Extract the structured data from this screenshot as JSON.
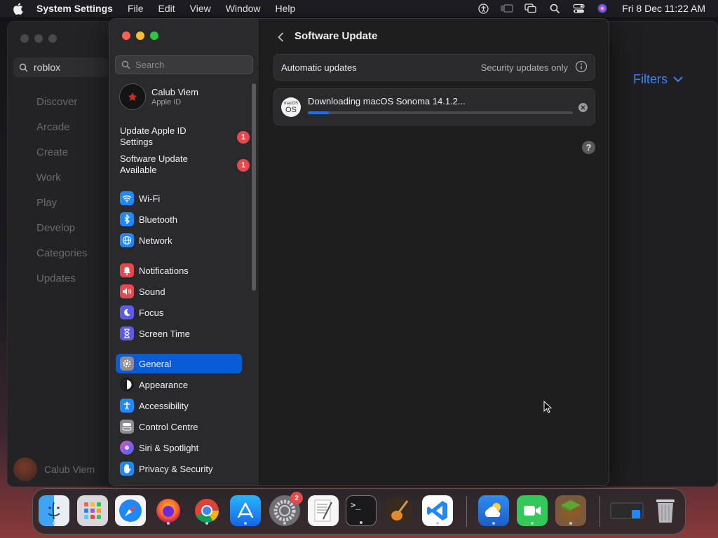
{
  "menubar": {
    "app_name": "System Settings",
    "menus": [
      "File",
      "Edit",
      "View",
      "Window",
      "Help"
    ],
    "clock": "Fri 8 Dec  11:22 AM"
  },
  "background_window": {
    "search_value": "roblox",
    "nav_items": [
      "Discover",
      "Arcade",
      "Create",
      "Work",
      "Play",
      "Develop",
      "Categories",
      "Updates"
    ],
    "user_name": "Calub Viem",
    "filters_label": "Filters"
  },
  "sidebar": {
    "search_placeholder": "Search",
    "account": {
      "name": "Calub Viem",
      "subtitle": "Apple ID"
    },
    "notices": [
      {
        "label": "Update Apple ID Settings",
        "badge": "1"
      },
      {
        "label": "Software Update Available",
        "badge": "1"
      }
    ],
    "items": [
      {
        "label": "Wi-Fi",
        "icon": "wifi-icon",
        "color": "#1e88ff"
      },
      {
        "label": "Bluetooth",
        "icon": "bluetooth-icon",
        "color": "#1e88ff"
      },
      {
        "label": "Network",
        "icon": "globe-icon",
        "color": "#1e88ff"
      },
      {
        "label": "Notifications",
        "icon": "bell-icon",
        "color": "#e5484d"
      },
      {
        "label": "Sound",
        "icon": "speaker-icon",
        "color": "#e5484d"
      },
      {
        "label": "Focus",
        "icon": "moon-icon",
        "color": "#5e5ce6"
      },
      {
        "label": "Screen Time",
        "icon": "hourglass-icon",
        "color": "#5e5ce6"
      },
      {
        "label": "General",
        "icon": "gear-icon",
        "color": "#8e8e93",
        "active": true
      },
      {
        "label": "Appearance",
        "icon": "appearance-icon",
        "color": "#1c1c1e"
      },
      {
        "label": "Accessibility",
        "icon": "accessibility-icon",
        "color": "#1e88ff"
      },
      {
        "label": "Control Centre",
        "icon": "toggles-icon",
        "color": "#8e8e93"
      },
      {
        "label": "Siri & Spotlight",
        "icon": "siri-icon",
        "color": "#b04fd6"
      },
      {
        "label": "Privacy & Security",
        "icon": "hand-icon",
        "color": "#1e88ff"
      }
    ]
  },
  "content": {
    "title": "Software Update",
    "auto_updates_label": "Automatic updates",
    "auto_updates_value": "Security updates only",
    "download_text": "Downloading macOS Sonoma 14.1.2...",
    "download_progress": 0.08,
    "macos_icon_top": "macOS",
    "macos_icon_bottom": "OS",
    "help_label": "?"
  },
  "dock": {
    "apps": [
      "Finder",
      "Launchpad",
      "Safari",
      "Firefox",
      "Chrome",
      "App Store",
      "System Settings",
      "TextEdit",
      "Terminal",
      "GarageBand",
      "Visual Studio Code",
      "Weather",
      "FaceTime",
      "Minecraft",
      "Downloads",
      "Trash"
    ],
    "system_settings_badge": "2",
    "terminal_prompt": ">_"
  }
}
